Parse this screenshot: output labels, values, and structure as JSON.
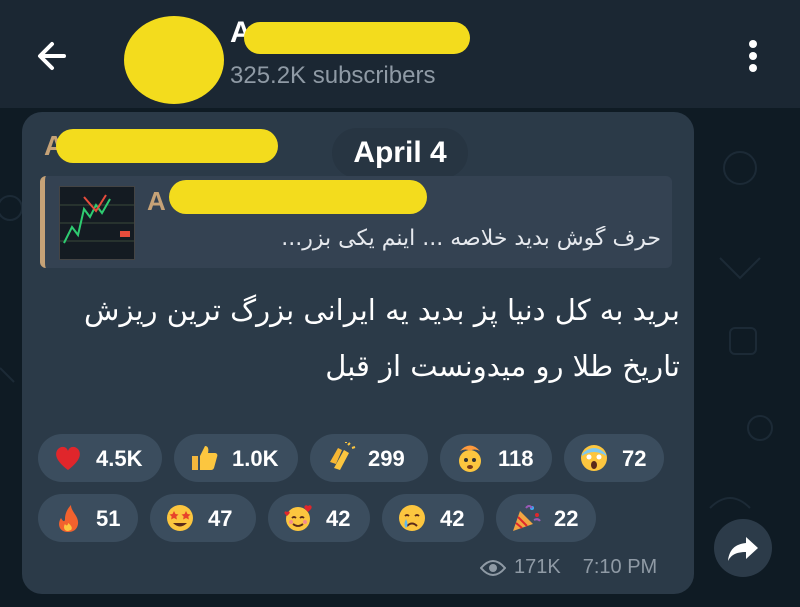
{
  "header": {
    "channel_name": "A",
    "subscribers": "325.2K subscribers"
  },
  "date_label": "April 4",
  "post": {
    "author": "A",
    "reply": {
      "author": "A",
      "text": "حرف گوش بدید  خلاصه ... اینم یکی بزر..."
    },
    "message": "برید به کل دنیا پز بدید یه ایرانی بزرگ ترین ریزش تاریخ طلا رو میدونست از قبل",
    "reactions": [
      {
        "emoji": "red-heart-icon",
        "count": "4.5K"
      },
      {
        "emoji": "thumbs-up-icon",
        "count": "1.0K"
      },
      {
        "emoji": "clapping-hands-icon",
        "count": "299"
      },
      {
        "emoji": "exploding-head-icon",
        "count": "118"
      },
      {
        "emoji": "screaming-face-icon",
        "count": "72"
      },
      {
        "emoji": "fire-icon",
        "count": "51"
      },
      {
        "emoji": "star-struck-icon",
        "count": "47"
      },
      {
        "emoji": "smiling-hearts-icon",
        "count": "42"
      },
      {
        "emoji": "crying-face-icon",
        "count": "42"
      },
      {
        "emoji": "party-popper-icon",
        "count": "22"
      }
    ],
    "views": "171K",
    "time": "7:10 PM"
  },
  "colors": {
    "background": "#0f1b24",
    "header": "#1b2733",
    "bubble": "#2b3a48",
    "accent": "#c6a277",
    "redaction": "#f3dc1d"
  }
}
